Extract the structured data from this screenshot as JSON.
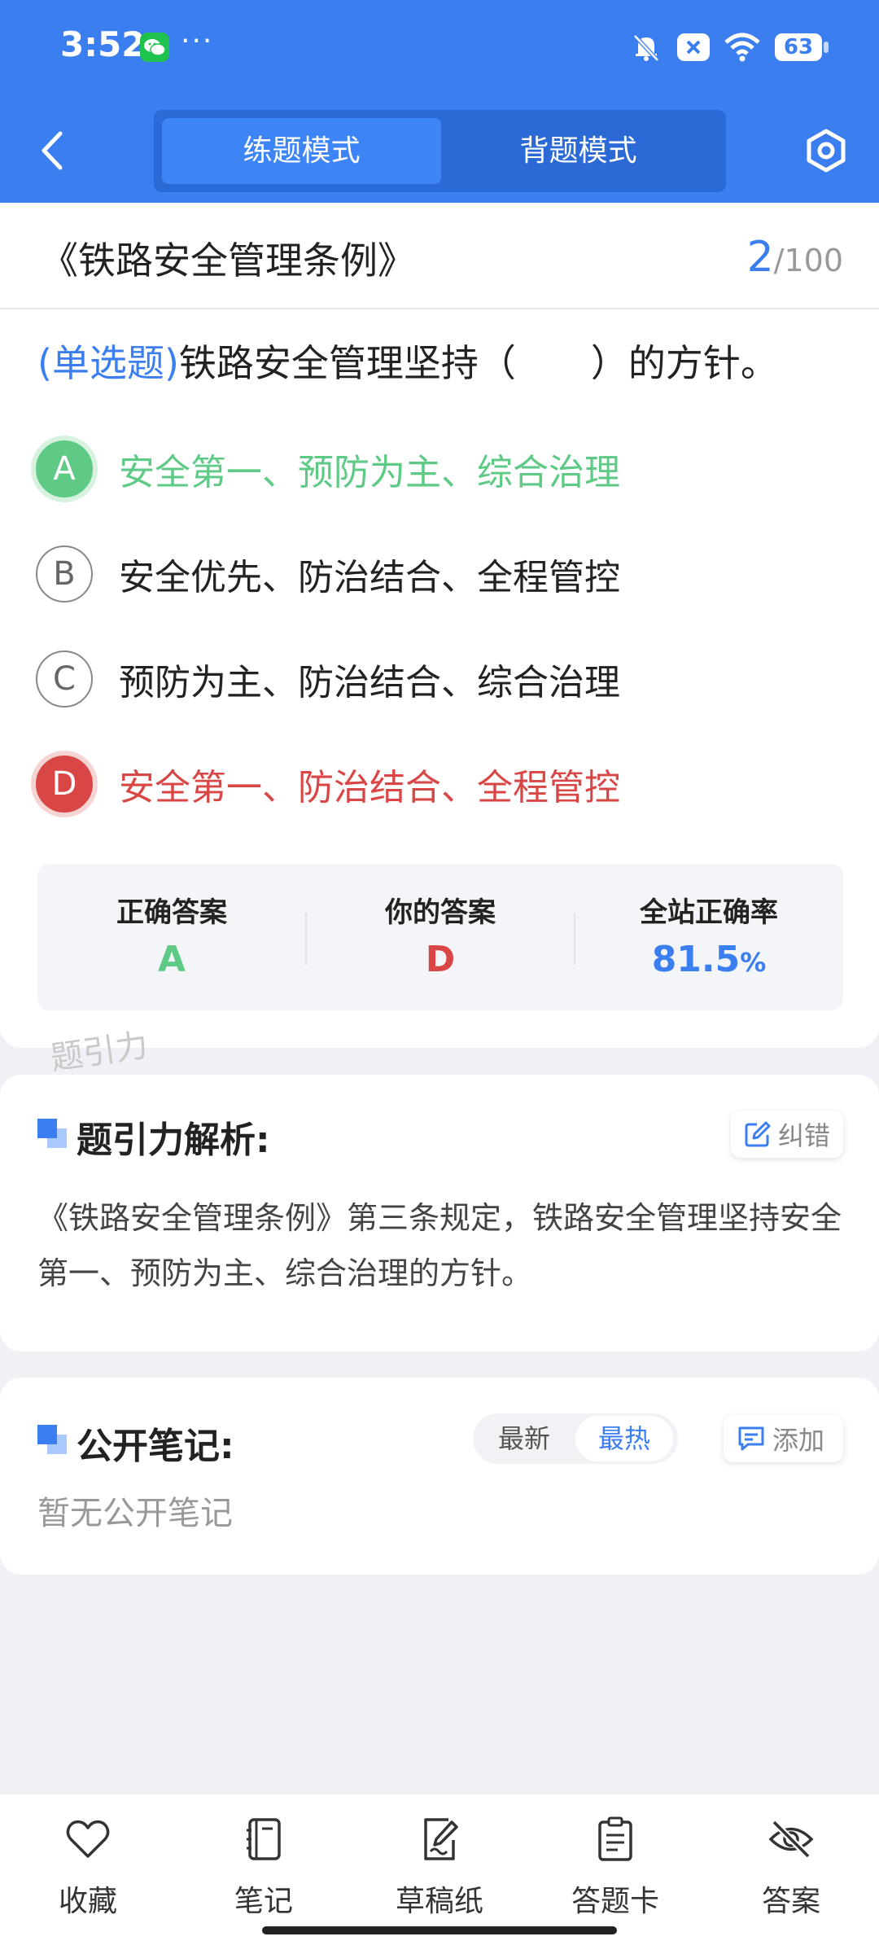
{
  "status_bar": {
    "time": "3:52",
    "more": "···",
    "battery": "63",
    "icons": [
      "wechat-icon",
      "bell-muted-icon",
      "close-badge-icon",
      "wifi-icon",
      "battery-icon"
    ]
  },
  "header": {
    "tabs": [
      {
        "label": "练题模式",
        "active": true
      },
      {
        "label": "背题模式",
        "active": false
      }
    ],
    "color": "#3b7ef0"
  },
  "question": {
    "doc_title": "《铁路安全管理条例》",
    "current": "2",
    "total": "/100",
    "type": "(单选题)",
    "text": "铁路安全管理坚持（　　）的方针。",
    "options": [
      {
        "letter": "A",
        "text": "安全第一、预防为主、综合治理",
        "state": "correct"
      },
      {
        "letter": "B",
        "text": "安全优先、防治结合、全程管控",
        "state": "normal"
      },
      {
        "letter": "C",
        "text": "预防为主、防治结合、综合治理",
        "state": "normal"
      },
      {
        "letter": "D",
        "text": "安全第一、防治结合、全程管控",
        "state": "wrong"
      }
    ]
  },
  "answer_summary": {
    "correct_label": "正确答案",
    "correct_value": "A",
    "yours_label": "你的答案",
    "yours_value": "D",
    "rate_label": "全站正确率",
    "rate_value": "81.5",
    "rate_unit": "%"
  },
  "watermark": "题引力",
  "analysis": {
    "title": "题引力解析:",
    "report_label": "纠错",
    "text": "《铁路安全管理条例》第三条规定，铁路安全管理坚持安全第一、预防为主、综合治理的方针。"
  },
  "notes": {
    "title": "公开笔记:",
    "sort_options": [
      "最新",
      "最热"
    ],
    "sort_selected": "最热",
    "add_label": "添加",
    "empty_text": "暂无公开笔记"
  },
  "bottom_nav": [
    {
      "label": "收藏",
      "icon": "heart-icon"
    },
    {
      "label": "笔记",
      "icon": "notebook-icon"
    },
    {
      "label": "草稿纸",
      "icon": "draft-icon"
    },
    {
      "label": "答题卡",
      "icon": "answer-card-icon"
    },
    {
      "label": "答案",
      "icon": "eye-off-icon"
    }
  ],
  "colors": {
    "primary": "#3b7ef0",
    "correct": "#5fca86",
    "wrong": "#d94646"
  }
}
